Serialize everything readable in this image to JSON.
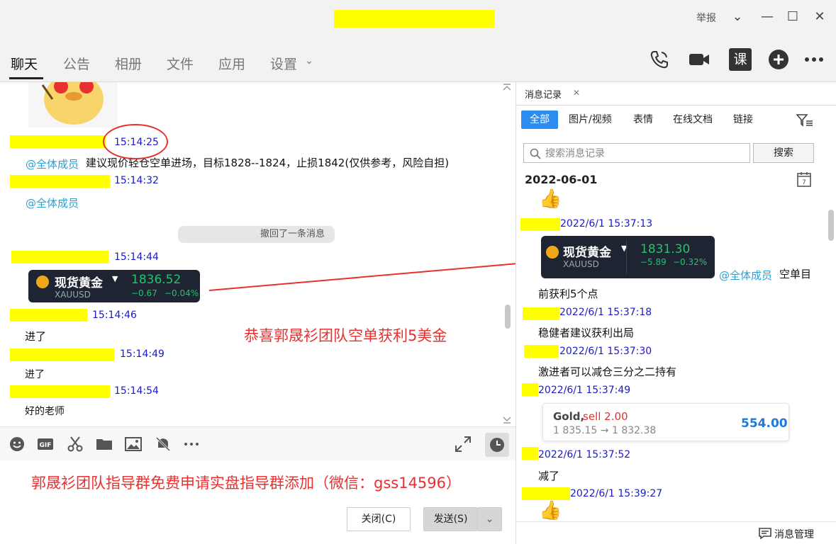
{
  "titlebar": {
    "report": "举报",
    "colors": {
      "highlight": "#ffff00"
    }
  },
  "nav": {
    "tabs": [
      "聊天",
      "公告",
      "相册",
      "文件",
      "应用",
      "设置"
    ],
    "icons": [
      "phone-icon",
      "video-icon",
      "course-icon",
      "add-icon",
      "more-icon"
    ],
    "course_glyph": "课"
  },
  "chat": {
    "messages": [
      {
        "time": "15:14:25",
        "mention": "@全体成员",
        "text": "建议现价轻仓空单进场，目标1828--1824，止损1842(仅供参考，风险自担)"
      },
      {
        "time": "15:14:32",
        "mention": "@全体成员"
      },
      {
        "system": "撤回了一条消息"
      },
      {
        "time": "15:14:44"
      },
      {
        "time": "15:14:46",
        "text": "进了"
      },
      {
        "time": "15:14:49",
        "text": "进了"
      },
      {
        "time": "15:14:54",
        "text": "好的老师"
      }
    ],
    "card": {
      "name": "现货黄金",
      "code": "XAUUSD",
      "price": "1836.52",
      "change": "−0.67",
      "change_pct": "−0.04%"
    },
    "annotation": "恭喜郭晟衫团队空单获利5美金"
  },
  "input": {
    "text": "郭晟衫团队指导群免费申请实盘指导群添加（微信：gss14596）",
    "close_label": "关闭(C)",
    "send_label": "发送(S)"
  },
  "panel": {
    "tab": "消息记录",
    "filters": [
      "全部",
      "图片/视频",
      "表情",
      "在线文档",
      "链接"
    ],
    "search_placeholder": "搜索消息记录",
    "search_label": "搜索",
    "date": "2022-06-01",
    "records": [
      {
        "time": "2022/6/1 15:37:13"
      },
      {
        "mention": "@全体成员",
        "text_a": "空单目",
        "text_b": "前获利5个点"
      },
      {
        "time": "2022/6/1 15:37:18",
        "text": "稳健者建议获利出局"
      },
      {
        "time": "2022/6/1 15:37:30",
        "text": "激进者可以减仓三分之二持有"
      },
      {
        "time": "2022/6/1 15:37:49"
      },
      {
        "time": "2022/6/1 15:37:52",
        "text": "减了"
      },
      {
        "time": "2022/6/1 15:39:27"
      }
    ],
    "card": {
      "name": "现货黄金",
      "code": "XAUUSD",
      "price": "1831.30",
      "change": "−5.89",
      "change_pct": "−0.32%"
    },
    "trade": {
      "gold": "Gold,",
      "side": "sell 2.00",
      "path": "1 835.15 → 1 832.38",
      "profit": "554.00"
    },
    "footer": "消息管理"
  }
}
